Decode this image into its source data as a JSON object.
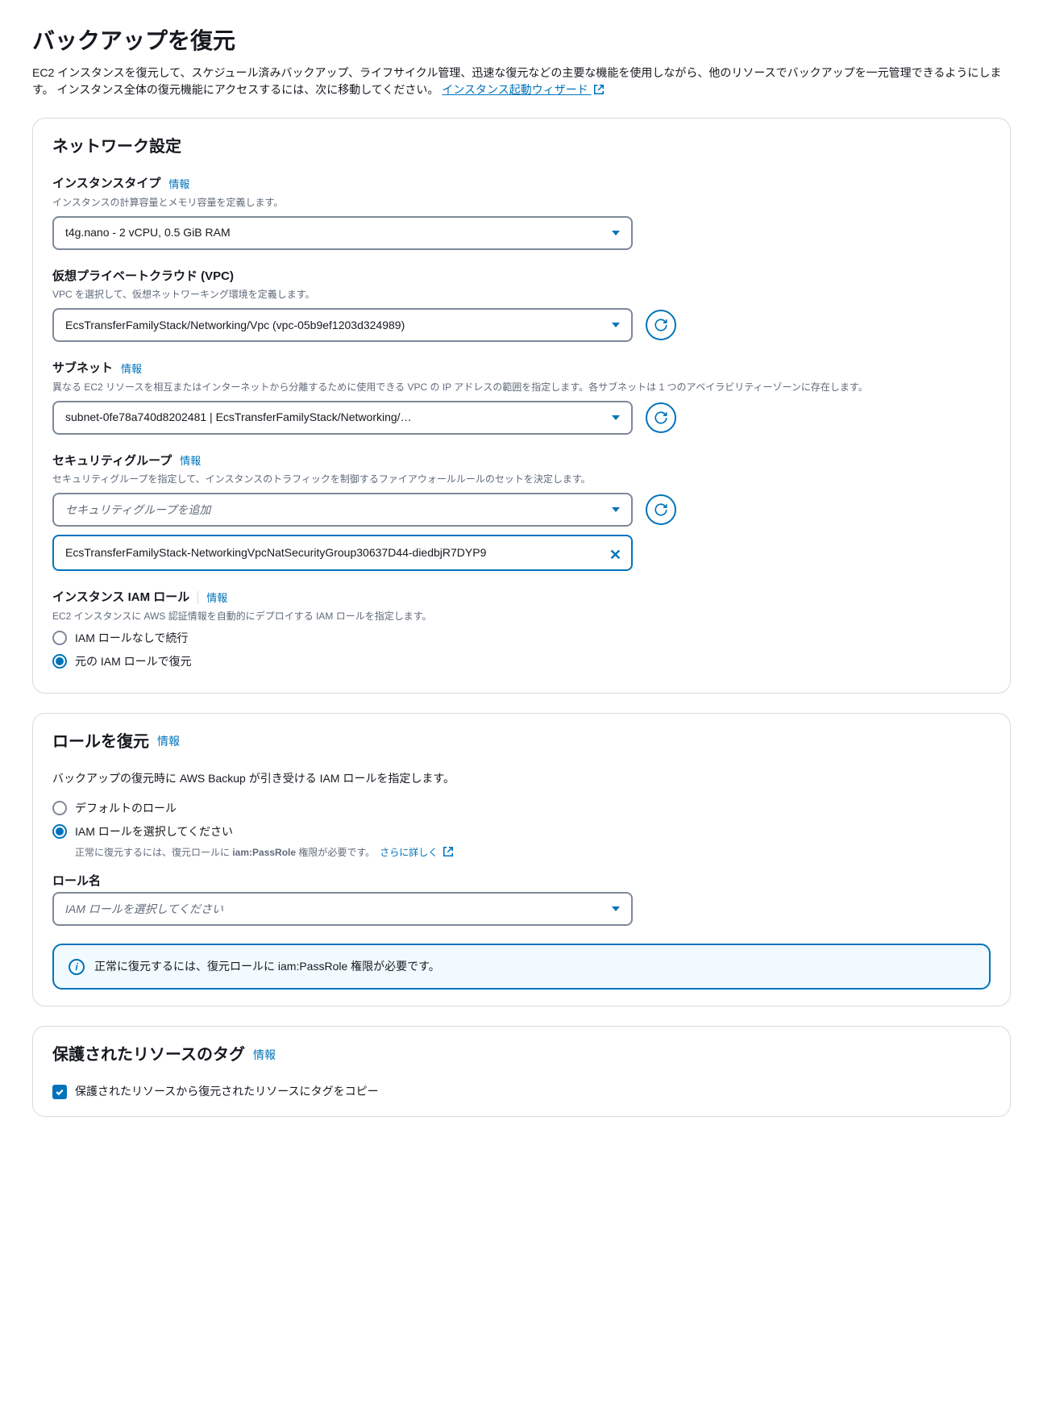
{
  "header": {
    "title": "バックアップを復元",
    "description": "EC2 インスタンスを復元して、スケジュール済みバックアップ、ライフサイクル管理、迅速な復元などの主要な機能を使用しながら、他のリソースでバックアップを一元管理できるようにします。 インスタンス全体の復元機能にアクセスするには、次に移動してください。",
    "wizard_link": "インスタンス起動ウィザード"
  },
  "info_label": "情報",
  "network": {
    "title": "ネットワーク設定",
    "instance_type": {
      "label": "インスタンスタイプ",
      "hint": "インスタンスの計算容量とメモリ容量を定義します。",
      "value": "t4g.nano - 2 vCPU, 0.5 GiB RAM"
    },
    "vpc": {
      "label": "仮想プライベートクラウド (VPC)",
      "hint": "VPC を選択して、仮想ネットワーキング環境を定義します。",
      "value": "EcsTransferFamilyStack/Networking/Vpc (vpc-05b9ef1203d324989)"
    },
    "subnet": {
      "label": "サブネット",
      "hint": "異なる EC2 リソースを相互またはインターネットから分離するために使用できる VPC の IP アドレスの範囲を指定します。各サブネットは 1 つのアベイラビリティーゾーンに存在します。",
      "value": "subnet-0fe78a740d8202481 | EcsTransferFamilyStack/Networking/…"
    },
    "security_group": {
      "label": "セキュリティグループ",
      "hint": "セキュリティグループを指定して、インスタンスのトラフィックを制御するファイアウォールルールのセットを決定します。",
      "placeholder": "セキュリティグループを追加",
      "token": "EcsTransferFamilyStack-NetworkingVpcNatSecurityGroup30637D44-diedbjR7DYP9"
    },
    "iam_role": {
      "label": "インスタンス IAM ロール",
      "hint": "EC2 インスタンスに AWS 認証情報を自動的にデプロイする IAM ロールを指定します。",
      "option_none": "IAM ロールなしで続行",
      "option_original": "元の IAM ロールで復元"
    }
  },
  "restore_role": {
    "title": "ロールを復元",
    "hint": "バックアップの復元時に AWS Backup が引き受ける IAM ロールを指定します。",
    "option_default": "デフォルトのロール",
    "option_select": "IAM ロールを選択してください",
    "note_prefix": "正常に復元するには、復元ロールに ",
    "note_bold": "iam:PassRole",
    "note_suffix": " 権限が必要です。",
    "learn_more": "さらに詳しく",
    "role_name_label": "ロール名",
    "role_name_placeholder": "IAM ロールを選択してください",
    "banner": "正常に復元するには、復元ロールに iam:PassRole 権限が必要です。"
  },
  "tags": {
    "title": "保護されたリソースのタグ",
    "checkbox_label": "保護されたリソースから復元されたリソースにタグをコピー"
  }
}
